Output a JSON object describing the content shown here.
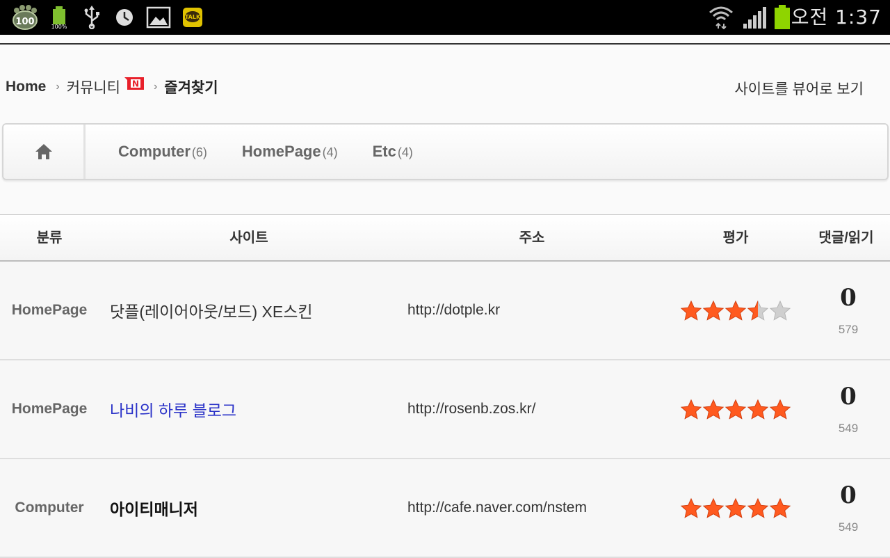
{
  "status_bar": {
    "battery_badge": "100",
    "battery_percent": "100%",
    "talk_label": "TALK",
    "clock": "오전 1:37",
    "icons": [
      "baidu-paw-icon",
      "battery-full-icon",
      "usb-icon",
      "clock-icon",
      "gallery-icon",
      "kakaotalk-icon",
      "wifi-icon",
      "signal-icon",
      "battery-icon"
    ]
  },
  "breadcrumb": {
    "home": "Home",
    "community": "커뮤니티",
    "new_badge": "N",
    "current": "즐겨찾기"
  },
  "view_site_label": "사이트를 뷰어로 보기",
  "categories": [
    {
      "name": "Computer",
      "count": "(6)"
    },
    {
      "name": "HomePage",
      "count": "(4)"
    },
    {
      "name": "Etc",
      "count": "(4)"
    }
  ],
  "table": {
    "headers": {
      "category": "분류",
      "site": "사이트",
      "url": "주소",
      "rating": "평가",
      "comments": "댓글/읽기"
    },
    "rows": [
      {
        "category": "HomePage",
        "site": "닷플(레이어아웃/보드) XE스킨",
        "url": "http://dotple.kr",
        "rating": 3.5,
        "comments": "0",
        "reads": "579"
      },
      {
        "category": "HomePage",
        "site": "나비의 하루 블로그",
        "url": "http://rosenb.zos.kr/",
        "rating": 5,
        "comments": "0",
        "reads": "549"
      },
      {
        "category": "Computer",
        "site": "아이티매니저",
        "url": "http://cafe.naver.com/nstem",
        "rating": 5,
        "comments": "0",
        "reads": "549"
      }
    ]
  },
  "colors": {
    "star_fill": "#ff5a1f",
    "star_empty": "#cfcfcf",
    "link_blue": "#2a32c8"
  }
}
